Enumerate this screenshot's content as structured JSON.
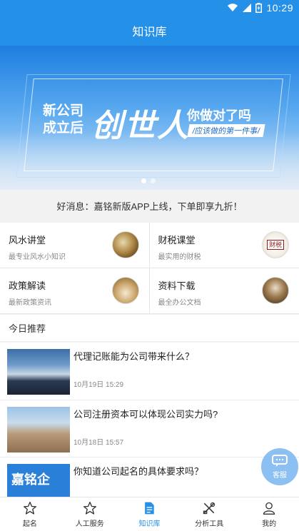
{
  "status_bar": {
    "time": "10:29"
  },
  "header": {
    "title": "知识库"
  },
  "banner": {
    "line1": "新公司",
    "line2": "成立后",
    "big": "创世人",
    "right": "你做对了吗",
    "tag": "/应该做的第一件事/"
  },
  "notice": {
    "text": "好消息：嘉铭新版APP上线，下单即享九折！"
  },
  "categories": [
    {
      "title": "风水讲堂",
      "sub": "最专业风水小知识"
    },
    {
      "title": "财税课堂",
      "sub": "最实用的财税"
    },
    {
      "title": "政策解读",
      "sub": "最新政策资讯"
    },
    {
      "title": "资料下载",
      "sub": "最全办公文档"
    }
  ],
  "tax_seal": "财税",
  "recommend": {
    "title": "今日推荐"
  },
  "articles": [
    {
      "headline": "代理记账能为公司带来什么？",
      "time": "10月19日 15:29"
    },
    {
      "headline": "公司注册资本可以体现公司实力吗?",
      "time": "10月18日 15:57"
    },
    {
      "headline": "你知道公司起名的具体要求吗？",
      "time": "",
      "logo_text": "嘉铭企"
    }
  ],
  "service": {
    "label": "客服"
  },
  "tabs": [
    {
      "label": "起名",
      "icon": "star-outline-icon"
    },
    {
      "label": "人工服务",
      "icon": "star-outline-icon"
    },
    {
      "label": "知识库",
      "icon": "document-icon",
      "active": true
    },
    {
      "label": "分析工具",
      "icon": "tools-icon"
    },
    {
      "label": "我的",
      "icon": "person-icon"
    }
  ],
  "colors": {
    "primary": "#2490e8",
    "text": "#222222",
    "muted": "#888888"
  }
}
